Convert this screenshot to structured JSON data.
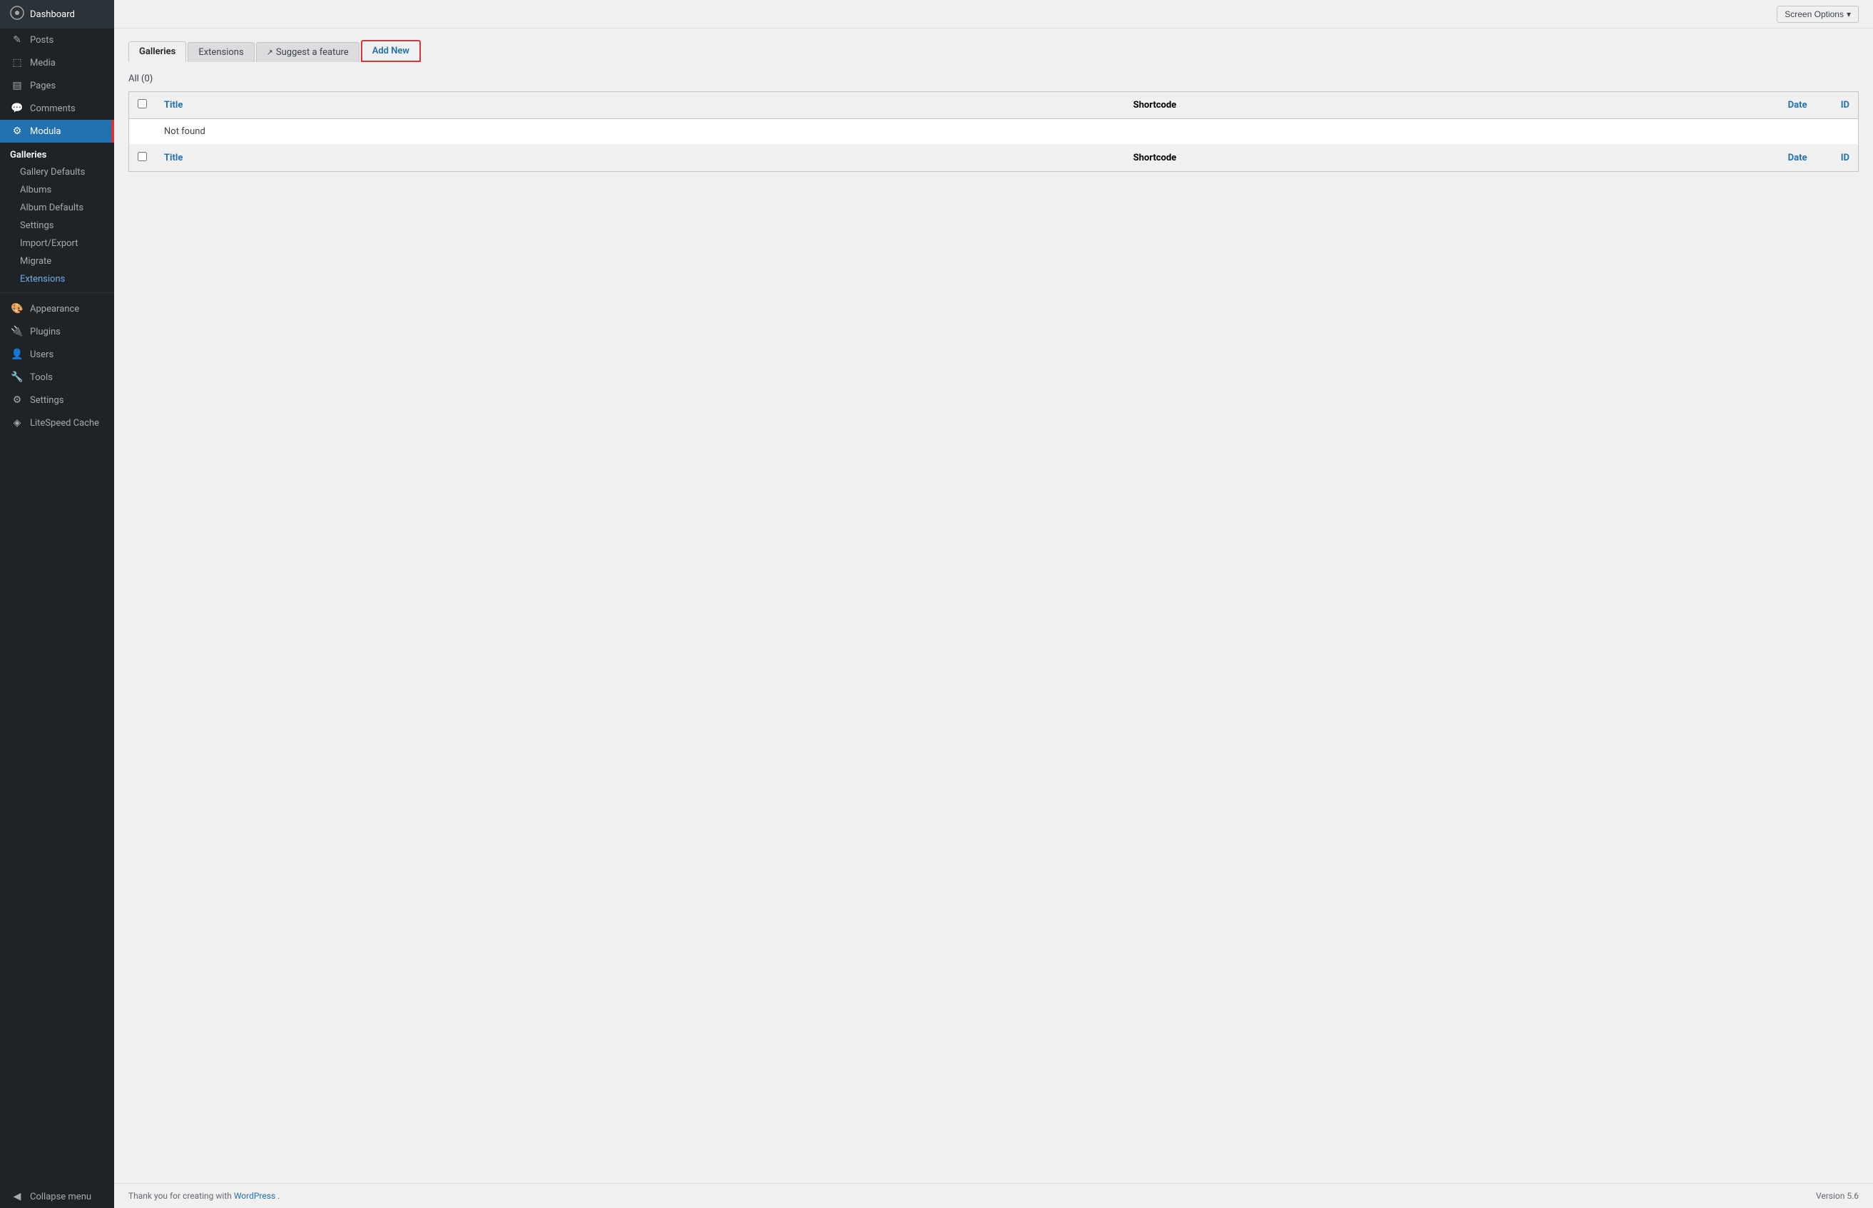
{
  "sidebar": {
    "items": [
      {
        "id": "dashboard",
        "label": "Dashboard",
        "icon": "⊞"
      },
      {
        "id": "posts",
        "label": "Posts",
        "icon": "📄"
      },
      {
        "id": "media",
        "label": "Media",
        "icon": "🖼"
      },
      {
        "id": "pages",
        "label": "Pages",
        "icon": "📋"
      },
      {
        "id": "comments",
        "label": "Comments",
        "icon": "💬"
      },
      {
        "id": "modula",
        "label": "Modula",
        "icon": "⚙",
        "active": true
      }
    ],
    "modula_sub": {
      "section_label": "Galleries",
      "items": [
        {
          "id": "gallery-defaults",
          "label": "Gallery Defaults"
        },
        {
          "id": "albums",
          "label": "Albums"
        },
        {
          "id": "album-defaults",
          "label": "Album Defaults"
        },
        {
          "id": "settings",
          "label": "Settings"
        },
        {
          "id": "import-export",
          "label": "Import/Export"
        },
        {
          "id": "migrate",
          "label": "Migrate"
        },
        {
          "id": "extensions",
          "label": "Extensions",
          "active": true
        }
      ]
    },
    "bottom_items": [
      {
        "id": "appearance",
        "label": "Appearance",
        "icon": "🎨"
      },
      {
        "id": "plugins",
        "label": "Plugins",
        "icon": "🔌"
      },
      {
        "id": "users",
        "label": "Users",
        "icon": "👤"
      },
      {
        "id": "tools",
        "label": "Tools",
        "icon": "🔧"
      },
      {
        "id": "settings",
        "label": "Settings",
        "icon": "⚙"
      },
      {
        "id": "litespeed-cache",
        "label": "LiteSpeed Cache",
        "icon": "◈"
      },
      {
        "id": "collapse-menu",
        "label": "Collapse menu",
        "icon": "◀"
      }
    ]
  },
  "topbar": {
    "screen_options_label": "Screen Options",
    "screen_options_arrow": "▾"
  },
  "tabs": [
    {
      "id": "galleries",
      "label": "Galleries",
      "active": true
    },
    {
      "id": "extensions",
      "label": "Extensions"
    },
    {
      "id": "suggest",
      "label": "Suggest a feature",
      "external": true
    },
    {
      "id": "add-new",
      "label": "Add New",
      "highlighted": true
    }
  ],
  "filter": {
    "label": "All",
    "count": "(0)"
  },
  "table": {
    "columns": [
      {
        "id": "cb",
        "label": ""
      },
      {
        "id": "title",
        "label": "Title",
        "link": true
      },
      {
        "id": "shortcode",
        "label": "Shortcode"
      },
      {
        "id": "date",
        "label": "Date",
        "link": true
      },
      {
        "id": "id",
        "label": "ID",
        "link": true
      }
    ],
    "rows": [],
    "empty_message": "Not found"
  },
  "footer": {
    "thank_you_text": "Thank you for creating with ",
    "wp_link_text": "WordPress",
    "version_text": "Version 5.6"
  }
}
